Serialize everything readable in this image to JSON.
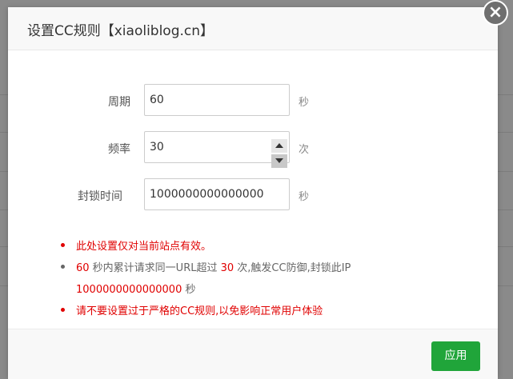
{
  "dialog": {
    "title": "设置CC规则【xiaoliblog.cn】",
    "close_glyph": "×"
  },
  "form": {
    "period": {
      "label": "周期",
      "value": "60",
      "unit": "秒"
    },
    "frequency": {
      "label": "频率",
      "value": "30",
      "unit": "次"
    },
    "block_time": {
      "label": "封锁时间",
      "value": "1000000000000000",
      "unit": "秒"
    }
  },
  "notes": {
    "note1": "此处设置仅对当前站点有效。",
    "note2_a": "60",
    "note2_b": " 秒内累计请求同一URL超过 ",
    "note2_c": "30",
    "note2_d": " 次,触发CC防御,封锁此IP",
    "note2_e": "1000000000000000",
    "note2_f": " 秒",
    "note3": "请不要设置过于严格的CC规则,以免影响正常用户体验"
  },
  "footer": {
    "apply_label": "应用"
  },
  "colors": {
    "accent_green": "#20a53a",
    "warning_red": "#e00000",
    "overlay": "#8a8a8a"
  }
}
